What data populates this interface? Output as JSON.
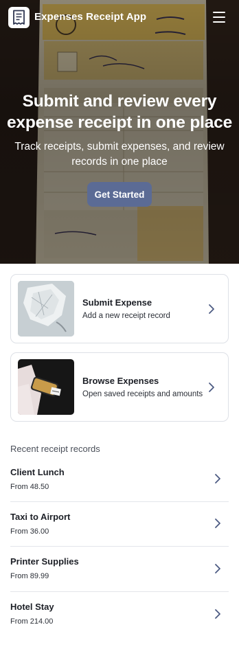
{
  "app": {
    "title": "Expenses Receipt App"
  },
  "hero": {
    "title": "Submit and review every expense receipt in one place",
    "subtitle": "Track receipts, submit expenses, and review records in one place",
    "cta_label": "Get Started"
  },
  "cards": [
    {
      "title": "Submit Expense",
      "description": "Add a new receipt record",
      "icon": "chevron-right-icon"
    },
    {
      "title": "Browse Expenses",
      "description": "Open saved receipts and amounts",
      "icon": "chevron-right-icon"
    }
  ],
  "recent": {
    "label": "Recent receipt records",
    "items": [
      {
        "title": "Client Lunch",
        "subtitle": "From 48.50"
      },
      {
        "title": "Taxi to Airport",
        "subtitle": "From 36.00"
      },
      {
        "title": "Printer Supplies",
        "subtitle": "From 89.99"
      },
      {
        "title": "Hotel Stay",
        "subtitle": "From 214.00"
      }
    ]
  },
  "colors": {
    "accent_button": "#5b6b95",
    "card_border": "#dde0e6",
    "chevron": "#4c5a82",
    "hero_background": "#3b2a1f"
  }
}
